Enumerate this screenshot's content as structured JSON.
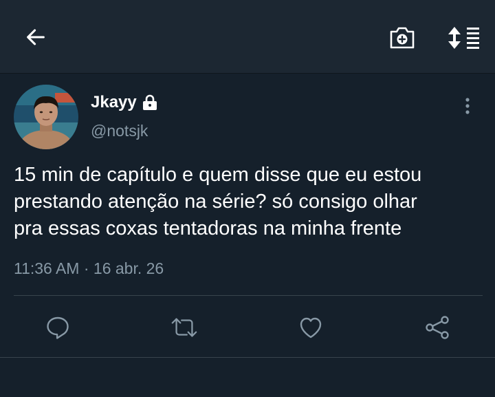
{
  "topbar": {
    "icons": [
      "back-arrow-icon",
      "camera-plus-icon",
      "sort-lines-icon"
    ]
  },
  "tweet": {
    "display_name": "Jkayy",
    "handle": "@notsjk",
    "protected_icon": "lock-icon",
    "text_lines": [
      "15 min de capítulo e quem disse que eu estou",
      "prestando atenção na série? só consigo olhar",
      "pra essas coxas tentadoras na minha frente"
    ],
    "timestamp": "11:36 AM · 16 abr. 26"
  },
  "actions": [
    "reply-icon",
    "retweet-icon",
    "like-icon",
    "share-icon"
  ],
  "colors": {
    "background": "#15202b",
    "topbar": "#1c2732",
    "secondary_text": "#8899a6",
    "divider": "#38444d"
  }
}
